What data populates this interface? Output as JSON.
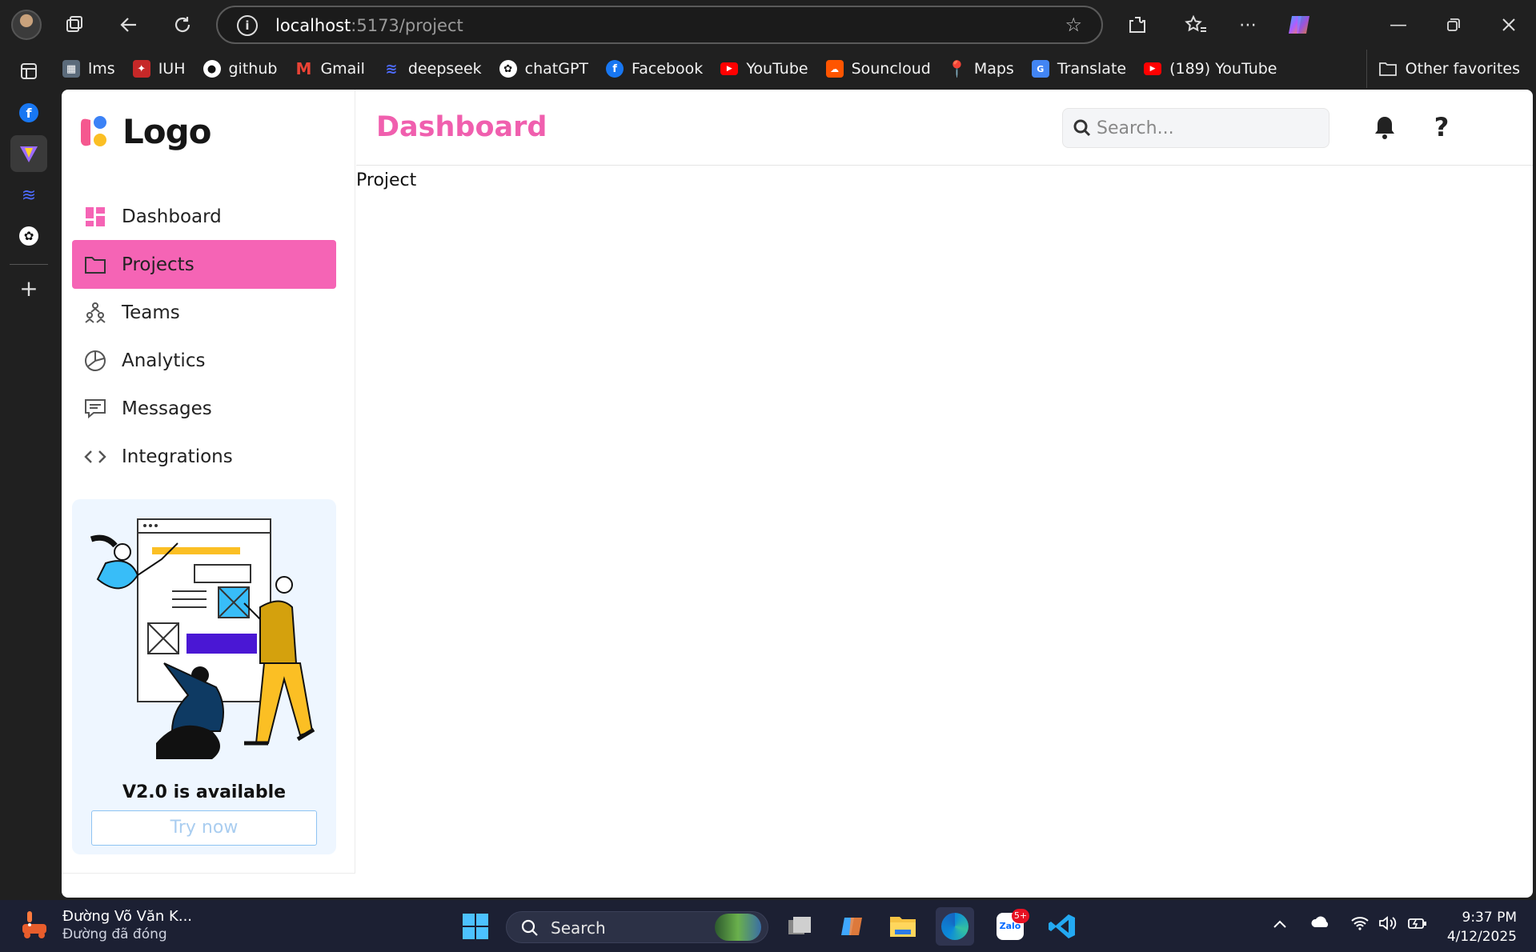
{
  "browser": {
    "url_host": "localhost",
    "url_path": ":5173/project",
    "favorites": [
      {
        "label": "lms",
        "icon": "lms-icon",
        "color": "#5b6b7b"
      },
      {
        "label": "IUH",
        "icon": "iuh-icon",
        "color": "#d32f2f"
      },
      {
        "label": "github",
        "icon": "github-icon",
        "color": "#fff"
      },
      {
        "label": "Gmail",
        "icon": "gmail-icon",
        "color": "#ea4335"
      },
      {
        "label": "deepseek",
        "icon": "deepseek-icon",
        "color": "#4d6bfe"
      },
      {
        "label": "chatGPT",
        "icon": "chatgpt-icon",
        "color": "#fff"
      },
      {
        "label": "Facebook",
        "icon": "facebook-icon",
        "color": "#1877f2"
      },
      {
        "label": "YouTube",
        "icon": "youtube-icon",
        "color": "#ff0000"
      },
      {
        "label": "Souncloud",
        "icon": "soundcloud-icon",
        "color": "#ff5500"
      },
      {
        "label": "Maps",
        "icon": "maps-icon",
        "color": "#34a853"
      },
      {
        "label": "Translate",
        "icon": "translate-icon",
        "color": "#4285f4"
      },
      {
        "label": "(189) YouTube",
        "icon": "youtube-icon",
        "color": "#ff0000"
      }
    ],
    "other_favorites": "Other favorites"
  },
  "app": {
    "logo_text": "Logo",
    "page_title": "Dashboard",
    "search_placeholder": "Search...",
    "content_text": "Project",
    "nav": [
      {
        "label": "Dashboard",
        "icon": "dashboard-icon",
        "active": false
      },
      {
        "label": "Projects",
        "icon": "folder-icon",
        "active": true
      },
      {
        "label": "Teams",
        "icon": "teams-icon",
        "active": false
      },
      {
        "label": "Analytics",
        "icon": "analytics-icon",
        "active": false
      },
      {
        "label": "Messages",
        "icon": "messages-icon",
        "active": false
      },
      {
        "label": "Integrations",
        "icon": "code-icon",
        "active": false
      }
    ],
    "promo": {
      "title": "V2.0 is available",
      "button": "Try now"
    },
    "accent": "#f564b5",
    "title_color": "#f05fae"
  },
  "taskbar": {
    "weather_line1": "Đường Võ Văn K...",
    "weather_line2": "Đường đã đóng",
    "search_label": "Search",
    "zalo_badge": "5+",
    "time": "9:37 PM",
    "date": "4/12/2025"
  }
}
